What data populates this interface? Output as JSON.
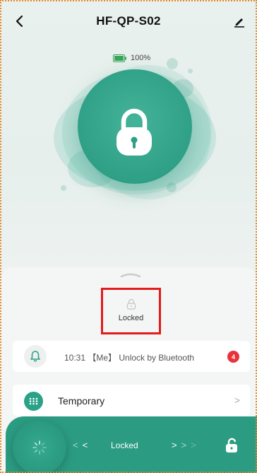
{
  "header": {
    "title": "HF-QP-S02",
    "back_icon": "chevron-left-icon",
    "edit_icon": "pencil-icon"
  },
  "battery": {
    "text": "100%",
    "level": 1.0,
    "color": "#3aa55a"
  },
  "lock_visual": {
    "icon": "padlock-keyhole-icon",
    "accent": "#2f9f86"
  },
  "status": {
    "icon": "lock-outline-icon",
    "label": "Locked",
    "highlight_color": "#e31b1b"
  },
  "log": {
    "icon": "bell-icon",
    "text": "10:31 【Me】 Unlock by Bluetooth",
    "badge_count": "4",
    "badge_color": "#e8333b"
  },
  "temporary": {
    "icon": "keypad-icon",
    "label": "Temporary",
    "chevron": ">"
  },
  "unlock_bar": {
    "left_arrows": [
      "<",
      "<"
    ],
    "label": "Locked",
    "right_arrows": [
      ">",
      ">",
      ">"
    ],
    "knob_icon": "loading-spinner-icon",
    "unlock_icon": "open-padlock-icon",
    "color": "#2b9c82"
  }
}
